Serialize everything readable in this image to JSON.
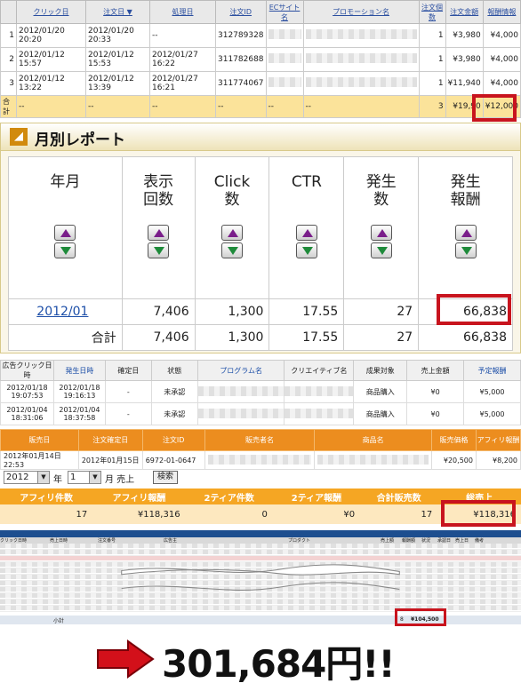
{
  "orders": {
    "headers": [
      "",
      "クリック日",
      "注文日 ▼",
      "処理日",
      "注文ID",
      "ECサイト名",
      "プロモーション名",
      "注文個数",
      "注文金額",
      "報酬情報"
    ],
    "rows": [
      {
        "no": "1",
        "click": "2012/01/20 20:20",
        "order": "2012/01/20 20:33",
        "proc": "--",
        "id": "312789328",
        "qty": "1",
        "amount": "¥3,980",
        "reward": "¥4,000"
      },
      {
        "no": "2",
        "click": "2012/01/12 15:57",
        "order": "2012/01/12 15:53",
        "proc": "2012/01/27 16:22",
        "id": "311782688",
        "qty": "1",
        "amount": "¥3,980",
        "reward": "¥4,000"
      },
      {
        "no": "3",
        "click": "2012/01/12 13:22",
        "order": "2012/01/12 13:39",
        "proc": "2012/01/27 16:21",
        "id": "311774067",
        "qty": "1",
        "amount": "¥11,940",
        "reward": "¥4,000"
      }
    ],
    "total": {
      "label": "合計",
      "dash": "--",
      "qty": "3",
      "amount": "¥19,90",
      "reward": "¥12,000"
    }
  },
  "monthly": {
    "title": "月別レポート",
    "headers": [
      "年月",
      "表示回数",
      "Click数",
      "CTR",
      "発生数",
      "発生報酬"
    ],
    "row": {
      "month": "2012/01",
      "views": "7,406",
      "clicks": "1,300",
      "ctr": "17.55",
      "count": "27",
      "reward": "66,838"
    },
    "total": {
      "label": "合計",
      "views": "7,406",
      "clicks": "1,300",
      "ctr": "17.55",
      "count": "27",
      "reward": "66,838"
    }
  },
  "clicks": {
    "headers": [
      "広告クリック日時",
      "発生日時",
      "確定日",
      "状態",
      "プログラム名",
      "クリエイティブ名",
      "成果対象",
      "売上金額",
      "予定報酬"
    ],
    "rows": [
      {
        "click": "2012/01/18 19:07:53",
        "occur": "2012/01/18 19:16:13",
        "fix": "-",
        "state": "未承認",
        "target": "商品購入",
        "sales": "¥0",
        "reward": "¥5,000"
      },
      {
        "click": "2012/01/04 18:31:06",
        "occur": "2012/01/04 18:37:58",
        "fix": "-",
        "state": "未承認",
        "target": "商品購入",
        "sales": "¥0",
        "reward": "¥5,000"
      }
    ]
  },
  "sales": {
    "headers": [
      "販売日",
      "注文確定日",
      "注文ID",
      "販売者名",
      "商品名",
      "販売価格",
      "アフィリ報酬"
    ],
    "row": {
      "date": "2012年01月14日 22:53",
      "confirm": "2012年01月15日",
      "id": "6972-01-0647",
      "price": "¥20,500",
      "reward": "¥8,200"
    }
  },
  "summary": {
    "year": "2012",
    "year_unit": "年",
    "month": "1",
    "month_unit": "月 売上",
    "search_label": "検索",
    "headers": [
      "アフィリ件数",
      "アフィリ報酬",
      "2ティア件数",
      "2ティア報酬",
      "合計販売数",
      "総売上"
    ],
    "values": [
      "17",
      "¥118,316",
      "0",
      "¥0",
      "17",
      "¥118,316"
    ]
  },
  "sheet": {
    "headers": [
      "クリック日時",
      "売上日時",
      "注文番号",
      "広告主",
      "プロダクト",
      "売上額",
      "報酬額",
      "状況",
      "承認日",
      "売上日",
      "備考"
    ],
    "subtotal_label": "小計",
    "subtotal_count": "8",
    "subtotal_value": "¥104,500"
  },
  "grand_total": "301,684円!!",
  "colors": {
    "highlight_box": "#c8141e",
    "orange": "#ec8d1f",
    "arrow": "#d3101a"
  }
}
